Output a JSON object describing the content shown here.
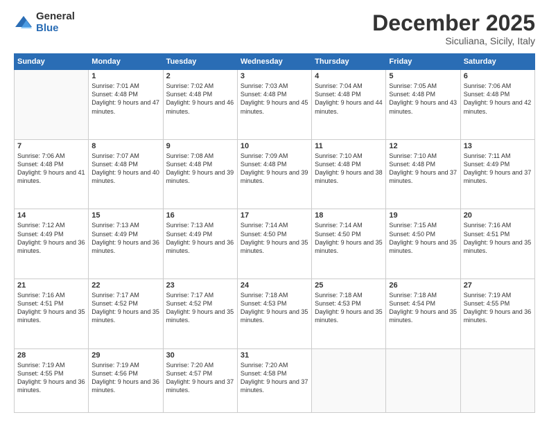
{
  "logo": {
    "general": "General",
    "blue": "Blue"
  },
  "header": {
    "month": "December 2025",
    "location": "Siculiana, Sicily, Italy"
  },
  "days": [
    "Sunday",
    "Monday",
    "Tuesday",
    "Wednesday",
    "Thursday",
    "Friday",
    "Saturday"
  ],
  "weeks": [
    [
      {
        "day": "",
        "sunrise": "",
        "sunset": "",
        "daylight": ""
      },
      {
        "day": "1",
        "sunrise": "Sunrise: 7:01 AM",
        "sunset": "Sunset: 4:48 PM",
        "daylight": "Daylight: 9 hours and 47 minutes."
      },
      {
        "day": "2",
        "sunrise": "Sunrise: 7:02 AM",
        "sunset": "Sunset: 4:48 PM",
        "daylight": "Daylight: 9 hours and 46 minutes."
      },
      {
        "day": "3",
        "sunrise": "Sunrise: 7:03 AM",
        "sunset": "Sunset: 4:48 PM",
        "daylight": "Daylight: 9 hours and 45 minutes."
      },
      {
        "day": "4",
        "sunrise": "Sunrise: 7:04 AM",
        "sunset": "Sunset: 4:48 PM",
        "daylight": "Daylight: 9 hours and 44 minutes."
      },
      {
        "day": "5",
        "sunrise": "Sunrise: 7:05 AM",
        "sunset": "Sunset: 4:48 PM",
        "daylight": "Daylight: 9 hours and 43 minutes."
      },
      {
        "day": "6",
        "sunrise": "Sunrise: 7:06 AM",
        "sunset": "Sunset: 4:48 PM",
        "daylight": "Daylight: 9 hours and 42 minutes."
      }
    ],
    [
      {
        "day": "7",
        "sunrise": "Sunrise: 7:06 AM",
        "sunset": "Sunset: 4:48 PM",
        "daylight": "Daylight: 9 hours and 41 minutes."
      },
      {
        "day": "8",
        "sunrise": "Sunrise: 7:07 AM",
        "sunset": "Sunset: 4:48 PM",
        "daylight": "Daylight: 9 hours and 40 minutes."
      },
      {
        "day": "9",
        "sunrise": "Sunrise: 7:08 AM",
        "sunset": "Sunset: 4:48 PM",
        "daylight": "Daylight: 9 hours and 39 minutes."
      },
      {
        "day": "10",
        "sunrise": "Sunrise: 7:09 AM",
        "sunset": "Sunset: 4:48 PM",
        "daylight": "Daylight: 9 hours and 39 minutes."
      },
      {
        "day": "11",
        "sunrise": "Sunrise: 7:10 AM",
        "sunset": "Sunset: 4:48 PM",
        "daylight": "Daylight: 9 hours and 38 minutes."
      },
      {
        "day": "12",
        "sunrise": "Sunrise: 7:10 AM",
        "sunset": "Sunset: 4:48 PM",
        "daylight": "Daylight: 9 hours and 37 minutes."
      },
      {
        "day": "13",
        "sunrise": "Sunrise: 7:11 AM",
        "sunset": "Sunset: 4:49 PM",
        "daylight": "Daylight: 9 hours and 37 minutes."
      }
    ],
    [
      {
        "day": "14",
        "sunrise": "Sunrise: 7:12 AM",
        "sunset": "Sunset: 4:49 PM",
        "daylight": "Daylight: 9 hours and 36 minutes."
      },
      {
        "day": "15",
        "sunrise": "Sunrise: 7:13 AM",
        "sunset": "Sunset: 4:49 PM",
        "daylight": "Daylight: 9 hours and 36 minutes."
      },
      {
        "day": "16",
        "sunrise": "Sunrise: 7:13 AM",
        "sunset": "Sunset: 4:49 PM",
        "daylight": "Daylight: 9 hours and 36 minutes."
      },
      {
        "day": "17",
        "sunrise": "Sunrise: 7:14 AM",
        "sunset": "Sunset: 4:50 PM",
        "daylight": "Daylight: 9 hours and 35 minutes."
      },
      {
        "day": "18",
        "sunrise": "Sunrise: 7:14 AM",
        "sunset": "Sunset: 4:50 PM",
        "daylight": "Daylight: 9 hours and 35 minutes."
      },
      {
        "day": "19",
        "sunrise": "Sunrise: 7:15 AM",
        "sunset": "Sunset: 4:50 PM",
        "daylight": "Daylight: 9 hours and 35 minutes."
      },
      {
        "day": "20",
        "sunrise": "Sunrise: 7:16 AM",
        "sunset": "Sunset: 4:51 PM",
        "daylight": "Daylight: 9 hours and 35 minutes."
      }
    ],
    [
      {
        "day": "21",
        "sunrise": "Sunrise: 7:16 AM",
        "sunset": "Sunset: 4:51 PM",
        "daylight": "Daylight: 9 hours and 35 minutes."
      },
      {
        "day": "22",
        "sunrise": "Sunrise: 7:17 AM",
        "sunset": "Sunset: 4:52 PM",
        "daylight": "Daylight: 9 hours and 35 minutes."
      },
      {
        "day": "23",
        "sunrise": "Sunrise: 7:17 AM",
        "sunset": "Sunset: 4:52 PM",
        "daylight": "Daylight: 9 hours and 35 minutes."
      },
      {
        "day": "24",
        "sunrise": "Sunrise: 7:18 AM",
        "sunset": "Sunset: 4:53 PM",
        "daylight": "Daylight: 9 hours and 35 minutes."
      },
      {
        "day": "25",
        "sunrise": "Sunrise: 7:18 AM",
        "sunset": "Sunset: 4:53 PM",
        "daylight": "Daylight: 9 hours and 35 minutes."
      },
      {
        "day": "26",
        "sunrise": "Sunrise: 7:18 AM",
        "sunset": "Sunset: 4:54 PM",
        "daylight": "Daylight: 9 hours and 35 minutes."
      },
      {
        "day": "27",
        "sunrise": "Sunrise: 7:19 AM",
        "sunset": "Sunset: 4:55 PM",
        "daylight": "Daylight: 9 hours and 36 minutes."
      }
    ],
    [
      {
        "day": "28",
        "sunrise": "Sunrise: 7:19 AM",
        "sunset": "Sunset: 4:55 PM",
        "daylight": "Daylight: 9 hours and 36 minutes."
      },
      {
        "day": "29",
        "sunrise": "Sunrise: 7:19 AM",
        "sunset": "Sunset: 4:56 PM",
        "daylight": "Daylight: 9 hours and 36 minutes."
      },
      {
        "day": "30",
        "sunrise": "Sunrise: 7:20 AM",
        "sunset": "Sunset: 4:57 PM",
        "daylight": "Daylight: 9 hours and 37 minutes."
      },
      {
        "day": "31",
        "sunrise": "Sunrise: 7:20 AM",
        "sunset": "Sunset: 4:58 PM",
        "daylight": "Daylight: 9 hours and 37 minutes."
      },
      {
        "day": "",
        "sunrise": "",
        "sunset": "",
        "daylight": ""
      },
      {
        "day": "",
        "sunrise": "",
        "sunset": "",
        "daylight": ""
      },
      {
        "day": "",
        "sunrise": "",
        "sunset": "",
        "daylight": ""
      }
    ]
  ]
}
